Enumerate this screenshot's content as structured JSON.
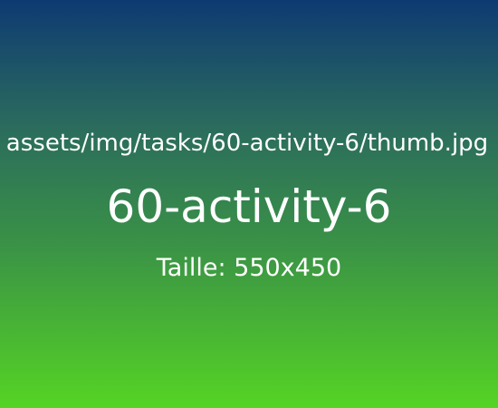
{
  "placeholder": {
    "path": "assets/img/tasks/60-activity-6/thumb.jpg",
    "title": "60-activity-6",
    "size_text": "Taille: 550x450"
  },
  "colors": {
    "gradient_top": "#0e3a72",
    "gradient_bottom": "#55d424",
    "text": "#ffffff"
  }
}
